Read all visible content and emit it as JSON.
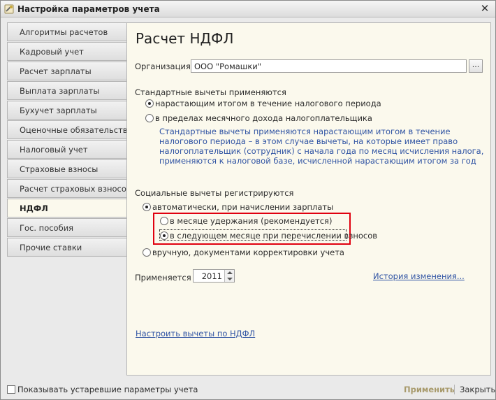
{
  "window": {
    "title": "Настройка параметров учета"
  },
  "sidebar": {
    "items": [
      {
        "label": "Алгоритмы расчетов"
      },
      {
        "label": "Кадровый учет"
      },
      {
        "label": "Расчет зарплаты"
      },
      {
        "label": "Выплата зарплаты"
      },
      {
        "label": "Бухучет зарплаты"
      },
      {
        "label": "Оценочные обязательства"
      },
      {
        "label": "Налоговый учет"
      },
      {
        "label": "Страховые взносы"
      },
      {
        "label": "Расчет страховых взносов"
      },
      {
        "label": "НДФЛ"
      },
      {
        "label": "Гос. пособия"
      },
      {
        "label": "Прочие ставки"
      }
    ],
    "active_index": 9
  },
  "main": {
    "title": "Расчет НДФЛ",
    "organization": {
      "label": "Организация:",
      "value": "ООО \"Ромашки\"",
      "select_button": "..."
    },
    "standard_deductions": {
      "label": "Стандартные вычеты применяются",
      "option_cumulative": "нарастающим итогом в течение налогового периода",
      "option_monthly": "в пределах месячного дохода налогоплательщика",
      "hint": "Стандартные вычеты применяются нарастающим итогом в течение налогового периода – в этом случае вычеты, на которые имеет право налогоплательщик (сотрудник) с начала года по месяц исчисления налога, применяются к налоговой базе, исчисленной нарастающим итогом за год"
    },
    "social_deductions": {
      "label": "Социальные вычеты регистрируются",
      "option_auto": "автоматически, при начислении зарплаты",
      "sub_option_withholding": "в месяце удержания (рекомендуется)",
      "sub_option_next_month": "в следующем месяце при перечислении взносов",
      "option_manual": "вручную, документами корректировки учета"
    },
    "applies_from": {
      "label": "Применяется с:",
      "year": "2011"
    },
    "history_link": "История изменения...",
    "configure_link": "Настроить вычеты по НДФЛ"
  },
  "footer": {
    "show_obsolete_label": "Показывать устаревшие параметры учета",
    "apply_button": "Применить",
    "close_button": "Закрыть"
  },
  "colors": {
    "highlight": "#e0000f",
    "link": "#2f53a3",
    "panel": "#fbf9ed"
  }
}
